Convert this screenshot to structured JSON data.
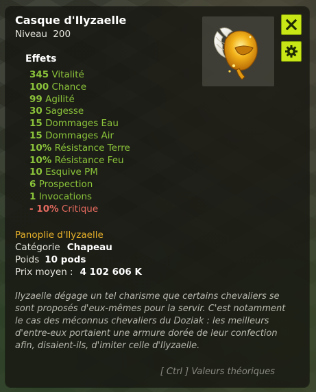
{
  "item": {
    "name": "Casque d'Ilyzaelle",
    "level_label": "Niveau",
    "level_value": "200"
  },
  "effects_label": "Effets",
  "effects": [
    {
      "value": "345",
      "stat": "Vitalité"
    },
    {
      "value": "100",
      "stat": "Chance"
    },
    {
      "value": "99",
      "stat": "Agilité"
    },
    {
      "value": "30",
      "stat": "Sagesse"
    },
    {
      "value": "15",
      "stat": "Dommages Eau"
    },
    {
      "value": "15",
      "stat": "Dommages Air"
    },
    {
      "value": "10%",
      "stat": "Résistance Terre"
    },
    {
      "value": "10%",
      "stat": "Résistance Feu"
    },
    {
      "value": "10",
      "stat": "Esquive PM"
    },
    {
      "value": "6",
      "stat": "Prospection"
    },
    {
      "value": "1",
      "stat": "Invocations"
    },
    {
      "value": "- 10%",
      "stat": "Critique"
    }
  ],
  "set_name": "Panoplie d'Ilyzaelle",
  "properties": {
    "category_label": "Catégorie",
    "category_value": "Chapeau",
    "weight_label": "Poids",
    "weight_value": "10 pods",
    "price_label": "Prix moyen :",
    "price_value": "4 102 606 K"
  },
  "description": "Ilyzaelle dégage un tel charisme que certains chevaliers se sont proposés d'eux-mêmes pour la servir. C'est notamment le cas des méconnus chevaliers du Doziak : les meilleurs d'entre-eux portaient une armure dorée de leur confection afin, disaient-ils, d'imiter celle d'Ilyzaelle.",
  "hint": "[ Ctrl ] Valeurs théoriques",
  "icons": {
    "close": "close-icon",
    "settings": "gear-icon",
    "item": "golden-helmet-icon"
  },
  "colors": {
    "positive_effect": "#8bc43a",
    "negative_effect": "#e56a5f",
    "set_name": "#e8b12a",
    "button": "#c8e516"
  }
}
